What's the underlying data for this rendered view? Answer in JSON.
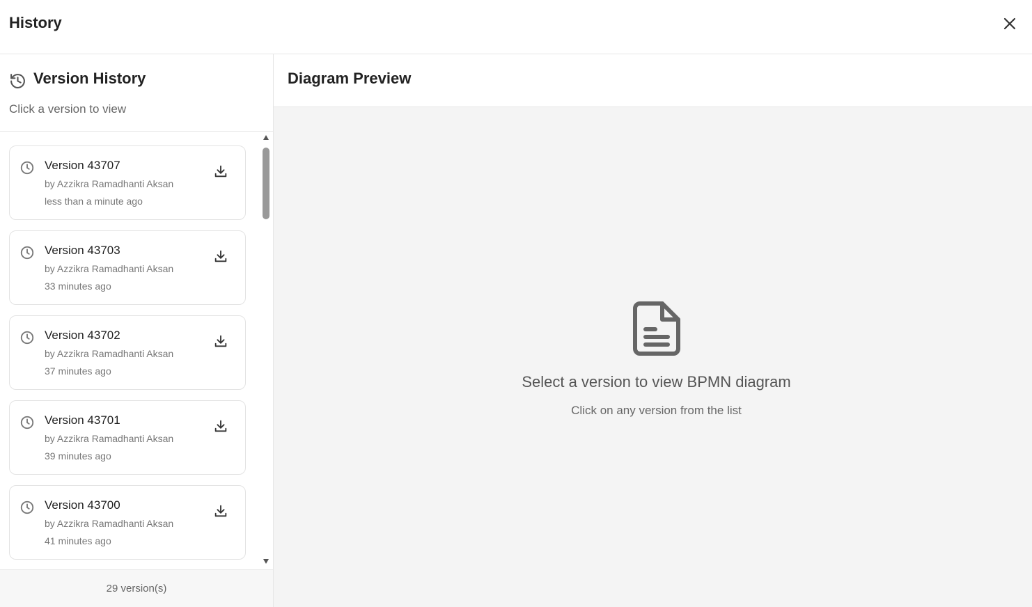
{
  "header": {
    "title": "History",
    "close_icon": "close-icon"
  },
  "sidebar": {
    "title": "Version History",
    "subtitle": "Click a version to view",
    "footer": "29 version(s)",
    "versions": [
      {
        "title": "Version 43707",
        "author": "by Azzikra Ramadhanti Aksan",
        "time": "less than a minute ago"
      },
      {
        "title": "Version 43703",
        "author": "by Azzikra Ramadhanti Aksan",
        "time": "33 minutes ago"
      },
      {
        "title": "Version 43702",
        "author": "by Azzikra Ramadhanti Aksan",
        "time": "37 minutes ago"
      },
      {
        "title": "Version 43701",
        "author": "by Azzikra Ramadhanti Aksan",
        "time": "39 minutes ago"
      },
      {
        "title": "Version 43700",
        "author": "by Azzikra Ramadhanti Aksan",
        "time": "41 minutes ago"
      }
    ]
  },
  "preview": {
    "title": "Diagram Preview",
    "empty_title": "Select a version to view BPMN diagram",
    "empty_subtitle": "Click on any version from the list"
  },
  "colors": {
    "border": "#e6e6e6",
    "preview_bg": "#f4f4f4",
    "icon": "#666666"
  }
}
